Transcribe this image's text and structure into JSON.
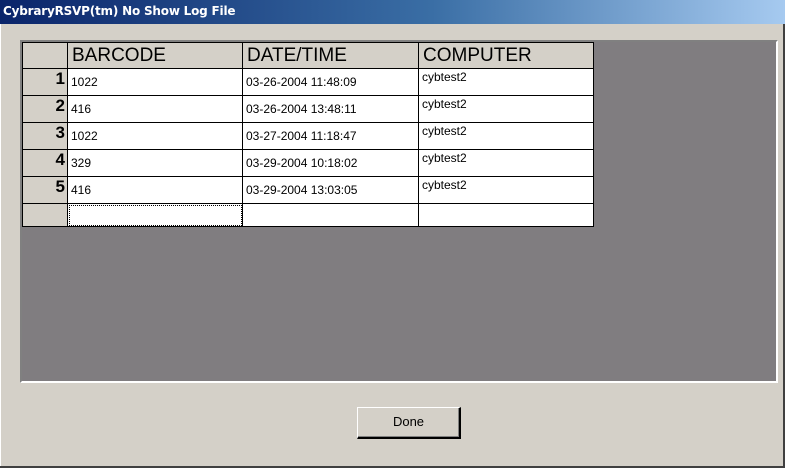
{
  "window": {
    "title": "CybraryRSVP(tm) No Show Log File"
  },
  "table": {
    "columns": [
      "BARCODE",
      "DATE/TIME",
      "COMPUTER"
    ],
    "rows": [
      {
        "num": "1",
        "barcode": "1022",
        "datetime": "03-26-2004 11:48:09",
        "computer": "cybtest2"
      },
      {
        "num": "2",
        "barcode": "416",
        "datetime": "03-26-2004 13:48:11",
        "computer": "cybtest2"
      },
      {
        "num": "3",
        "barcode": "1022",
        "datetime": "03-27-2004 11:18:47",
        "computer": "cybtest2"
      },
      {
        "num": "4",
        "barcode": "329",
        "datetime": "03-29-2004 10:18:02",
        "computer": "cybtest2"
      },
      {
        "num": "5",
        "barcode": "416",
        "datetime": "03-29-2004 13:03:05",
        "computer": "cybtest2"
      }
    ]
  },
  "buttons": {
    "done_label": "Done"
  }
}
